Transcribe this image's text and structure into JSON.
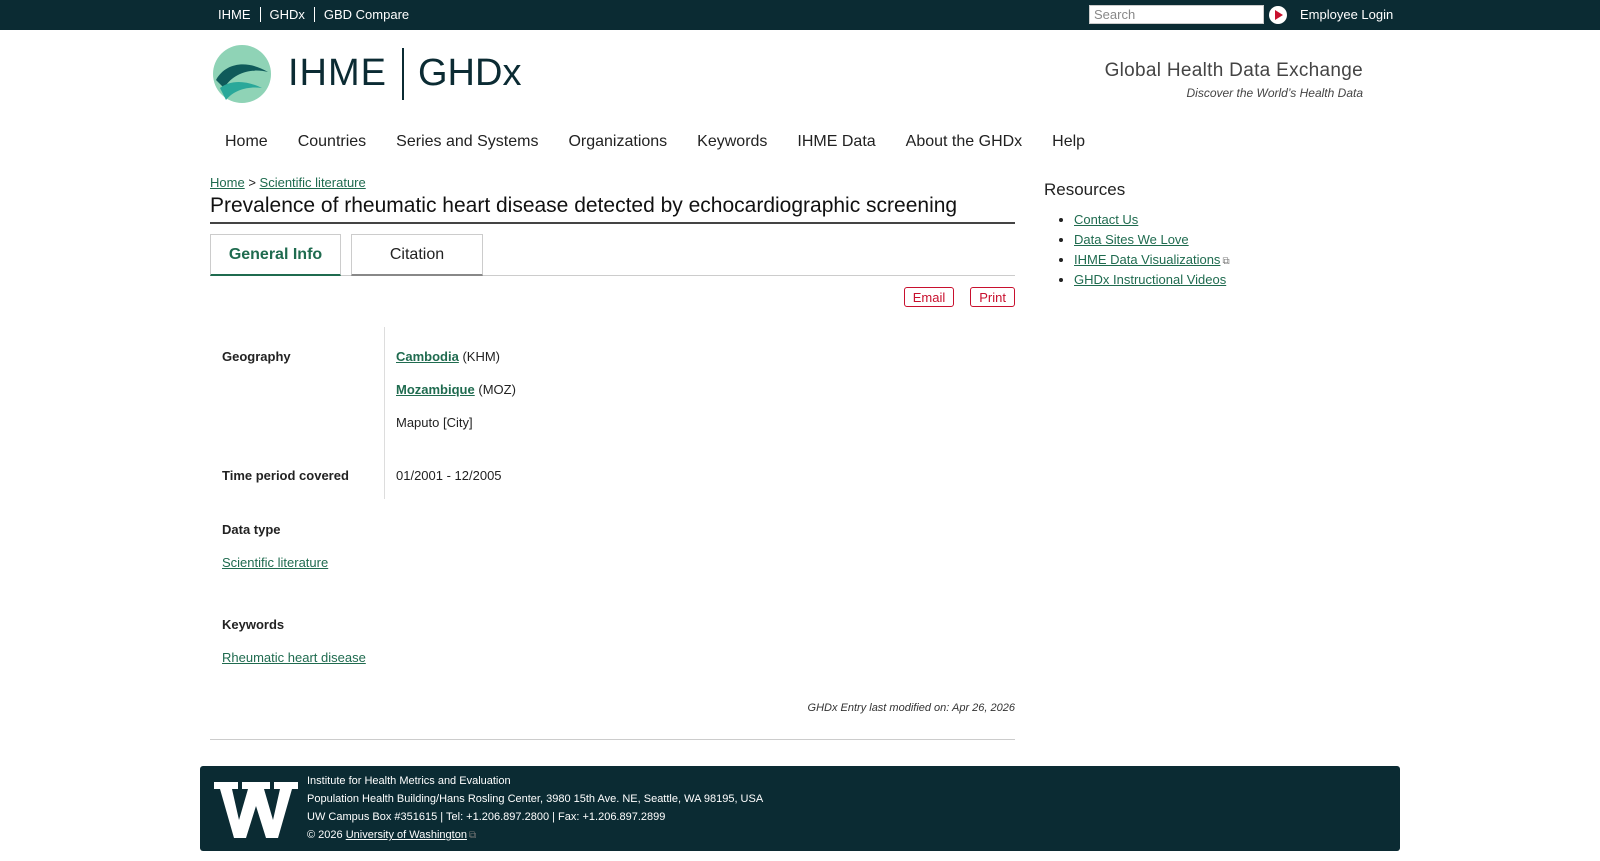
{
  "topbar": {
    "links": [
      "IHME",
      "GHDx",
      "GBD Compare"
    ],
    "search_placeholder": "Search",
    "login_label": "Employee Login"
  },
  "header": {
    "logo_ihme": "IHME",
    "logo_ghdx": "GHDx",
    "tagline_title": "Global Health Data Exchange",
    "tagline_sub": "Discover the World’s Health Data"
  },
  "nav": [
    "Home",
    "Countries",
    "Series and Systems",
    "Organizations",
    "Keywords",
    "IHME Data",
    "About the GHDx",
    "Help"
  ],
  "breadcrumb": {
    "home": "Home",
    "sep": ">",
    "current": "Scientific literature"
  },
  "page": {
    "title": "Prevalence of rheumatic heart disease detected by echocardiographic screening",
    "tabs": [
      "General Info",
      "Citation"
    ],
    "email_label": "Email",
    "print_label": "Print"
  },
  "info": {
    "geography_label": "Geography",
    "geo": [
      {
        "name": "Cambodia",
        "code": "(KHM)"
      },
      {
        "name": "Mozambique",
        "code": "(MOZ)"
      }
    ],
    "geo_city": "Maputo [City]",
    "time_label": "Time period covered",
    "time_value": "01/2001 - 12/2005",
    "datatype_label": "Data type",
    "datatype_value": "Scientific literature",
    "keywords_label": "Keywords",
    "keywords_value": "Rheumatic heart disease",
    "modified": "GHDx Entry last modified on: Apr 26, 2026"
  },
  "sidebar": {
    "title": "Resources",
    "items": [
      "Contact Us",
      "Data Sites We Love",
      "IHME Data Visualizations",
      "GHDx Instructional Videos"
    ]
  },
  "footer": {
    "line1": "Institute for Health Metrics and Evaluation",
    "line2": "Population Health Building/Hans Rosling Center, 3980 15th Ave. NE, Seattle, WA 98195, USA",
    "line3": "UW Campus Box #351615 | Tel: +1.206.897.2800 | Fax: +1.206.897.2899",
    "copyright": "© 2026",
    "uw_link": "University of Washington"
  },
  "colors": {
    "dark": "#0b2b33",
    "link": "#1f6b4f",
    "accent": "#c8102e"
  }
}
